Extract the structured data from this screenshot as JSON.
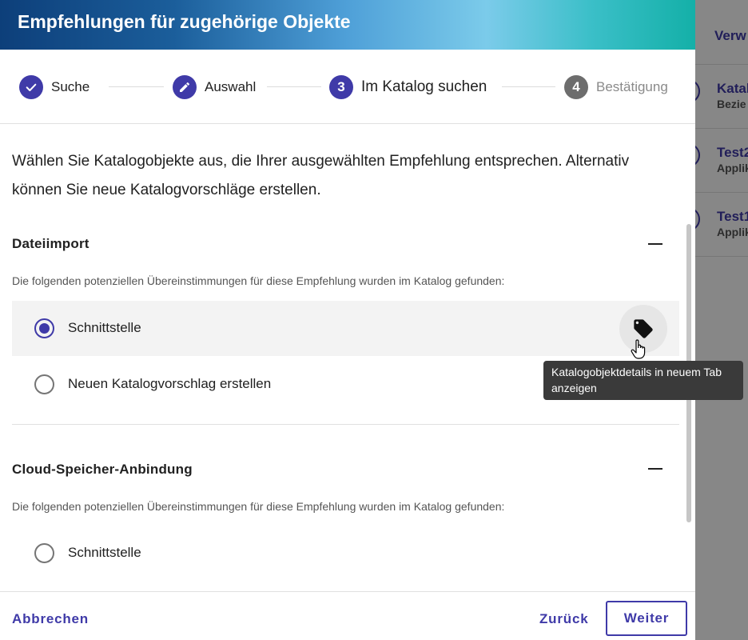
{
  "background": {
    "tab_label": "Verw",
    "items": [
      {
        "title": "Katal",
        "subtitle": "Bezie"
      },
      {
        "title": "Test2",
        "subtitle": "Applik"
      },
      {
        "title": "Test1",
        "subtitle": "Applik"
      }
    ]
  },
  "modal": {
    "title": "Empfehlungen für zugehörige Objekte",
    "steps": [
      {
        "label": "Suche",
        "state": "done",
        "icon": "check-icon"
      },
      {
        "label": "Auswahl",
        "state": "edit",
        "icon": "pencil-icon"
      },
      {
        "number": "3",
        "label": "Im Katalog suchen",
        "state": "active"
      },
      {
        "number": "4",
        "label": "Bestätigung",
        "state": "inactive"
      }
    ],
    "intro": "Wählen Sie Katalogobjekte aus, die Ihrer ausgewählten Empfehlung entsprechen. Alternativ können Sie neue Katalogvorschläge erstellen.",
    "sections": [
      {
        "title": "Dateiimport",
        "description": "Die folgenden potenziellen Übereinstimmungen für diese Empfehlung wurden im Katalog gefunden:",
        "options": [
          {
            "label": "Schnittstelle",
            "selected": true
          },
          {
            "label": "Neuen Katalogvorschlag erstellen",
            "selected": false
          }
        ]
      },
      {
        "title": "Cloud-Speicher-Anbindung",
        "description": "Die folgenden potenziellen Übereinstimmungen für diese Empfehlung wurden im Katalog gefunden:",
        "options": [
          {
            "label": "Schnittstelle",
            "selected": false
          }
        ]
      }
    ],
    "tooltip": "Katalogobjektdetails in neuem Tab anzeigen",
    "footer": {
      "cancel": "Abbrechen",
      "back": "Zurück",
      "next": "Weiter"
    }
  },
  "colors": {
    "accent": "#3f3aa8",
    "inactive_step": "#6d6d6d",
    "selected_row": "#f3f3f3"
  }
}
